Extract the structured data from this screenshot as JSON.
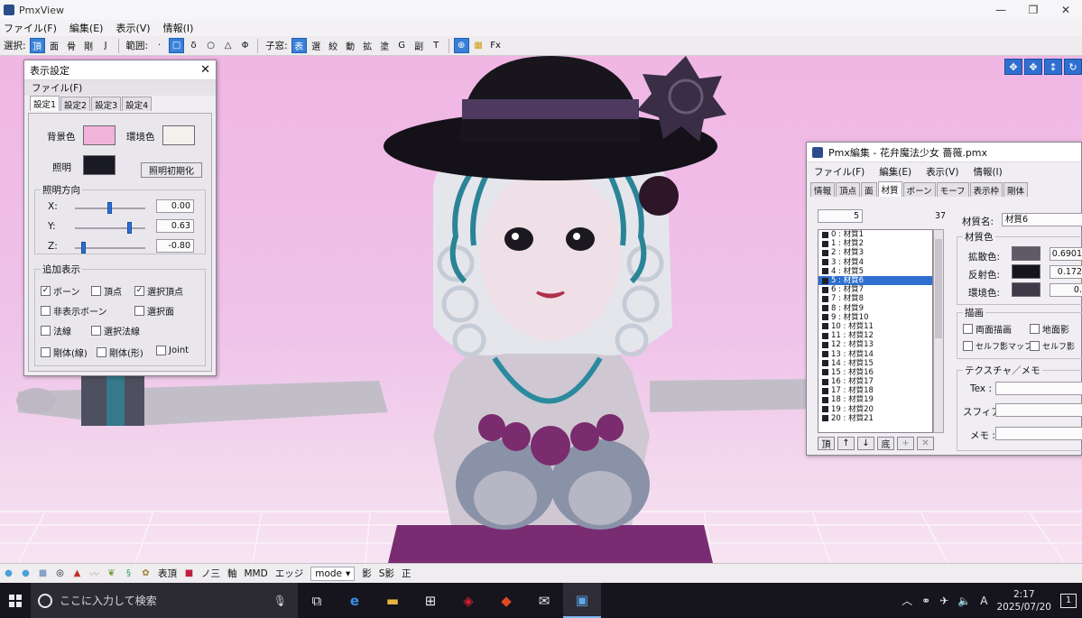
{
  "main_window": {
    "title": "PmxView",
    "window_controls": [
      "—",
      "❐",
      "✕"
    ],
    "menu": [
      "ファイル(F)",
      "編集(E)",
      "表示(V)",
      "情報(I)"
    ]
  },
  "toolbar": {
    "select_label": "選択:",
    "select_buttons": [
      "頂",
      "面",
      "骨",
      "剛",
      "J"
    ],
    "range_label": "範囲:",
    "range_buttons": [
      "·",
      "□",
      "δ",
      "○",
      "△",
      "Φ"
    ],
    "child_label": "子窓:",
    "child_buttons": [
      "表",
      "選",
      "絞",
      "動",
      "拡",
      "塗",
      "G",
      "副",
      "T"
    ],
    "extra_buttons": [
      "⊕",
      "▦",
      "Fx"
    ]
  },
  "nav_buttons": [
    "✥",
    "✥",
    "↕",
    "↻"
  ],
  "display_settings": {
    "title": "表示設定",
    "close": "✕",
    "menu": "ファイル(F)",
    "tabs": [
      "設定1",
      "設定2",
      "設定3",
      "設定4"
    ],
    "active_tab": 0,
    "bg_color_label": "背景色",
    "env_color_label": "環境色",
    "light_label": "照明",
    "light_reset_button": "照明初期化",
    "light_dir_label": "照明方向",
    "axis_x_label": "X:",
    "axis_y_label": "Y:",
    "axis_z_label": "Z:",
    "x_value": "0.00",
    "y_value": "0.63",
    "z_value": "-0.80",
    "x_slider": 0.5,
    "y_slider": 0.81,
    "z_slider": 0.1,
    "bg_color": "#f2b3d9",
    "env_color": "#f4f0ec",
    "light_color": "#1a1a24",
    "extra_display_label": "追加表示",
    "checkboxes": [
      {
        "label": "ボーン",
        "checked": true
      },
      {
        "label": "頂点",
        "checked": false
      },
      {
        "label": "選択頂点",
        "checked": true
      },
      {
        "label": "非表示ボーン",
        "checked": false
      },
      {
        "label": "選択面",
        "checked": false
      },
      {
        "label": "法線",
        "checked": false
      },
      {
        "label": "選択法線",
        "checked": false
      },
      {
        "label": "剛体(線)",
        "checked": false
      },
      {
        "label": "剛体(形)",
        "checked": false
      },
      {
        "label": "Joint",
        "checked": false
      }
    ]
  },
  "pmx_editor": {
    "title": "Pmx編集 - 花弁魔法少女 薔薇.pmx",
    "menu": [
      "ファイル(F)",
      "編集(E)",
      "表示(V)",
      "情報(I)"
    ],
    "tabs": [
      "情報",
      "頂点",
      "面",
      "材質",
      "ボーン",
      "モーフ",
      "表示枠",
      "剛体"
    ],
    "active_tab": 3,
    "index_value": "5",
    "count": "37",
    "materials": [
      "0 : 材質1",
      "1 : 材質2",
      "2 : 材質3",
      "3 : 材質4",
      "4 : 材質5",
      "5 : 材質6",
      "6 : 材質7",
      "7 : 材質8",
      "8 : 材質9",
      "9 : 材質10",
      "10 : 材質11",
      "11 : 材質12",
      "12 : 材質13",
      "13 : 材質14",
      "14 : 材質15",
      "15 : 材質16",
      "16 : 材質17",
      "17 : 材質18",
      "18 : 材質19",
      "19 : 材質20",
      "20 : 材質21"
    ],
    "selected_index": 5,
    "list_buttons": [
      "頂",
      "↑",
      "↓",
      "底",
      "+",
      "✕"
    ],
    "material_name_label": "材質名:",
    "material_name_value": "材質6",
    "material_color_group": "材質色",
    "diffuse_label": "拡散色:",
    "diffuse_value": "0.6901",
    "diffuse_color": "#5e5a66",
    "specular_label": "反射色:",
    "specular_value": "0.172",
    "specular_color": "#16141c",
    "ambient_label": "環境色:",
    "ambient_value": "0.",
    "ambient_color": "#3e3a48",
    "draw_group": "描画",
    "draw_checks": [
      "両面描画",
      "地面影",
      "セルフ影マップ",
      "セルフ影"
    ],
    "texture_group": "テクスチャ／メモ",
    "tex_label": "Tex :",
    "sphere_label": "スフィア :",
    "memo_label": "メモ :"
  },
  "statusbar": {
    "items": [
      "表頂",
      "ノ三",
      "軸",
      "MMD",
      "エッジ"
    ],
    "mode_label": "mode",
    "after_mode": [
      "影",
      "S影",
      "正"
    ]
  },
  "taskbar": {
    "search_placeholder": "ここに入力して検索",
    "time": "2:17",
    "date": "2025/07/20",
    "ime": "A",
    "notification_count": "1"
  }
}
